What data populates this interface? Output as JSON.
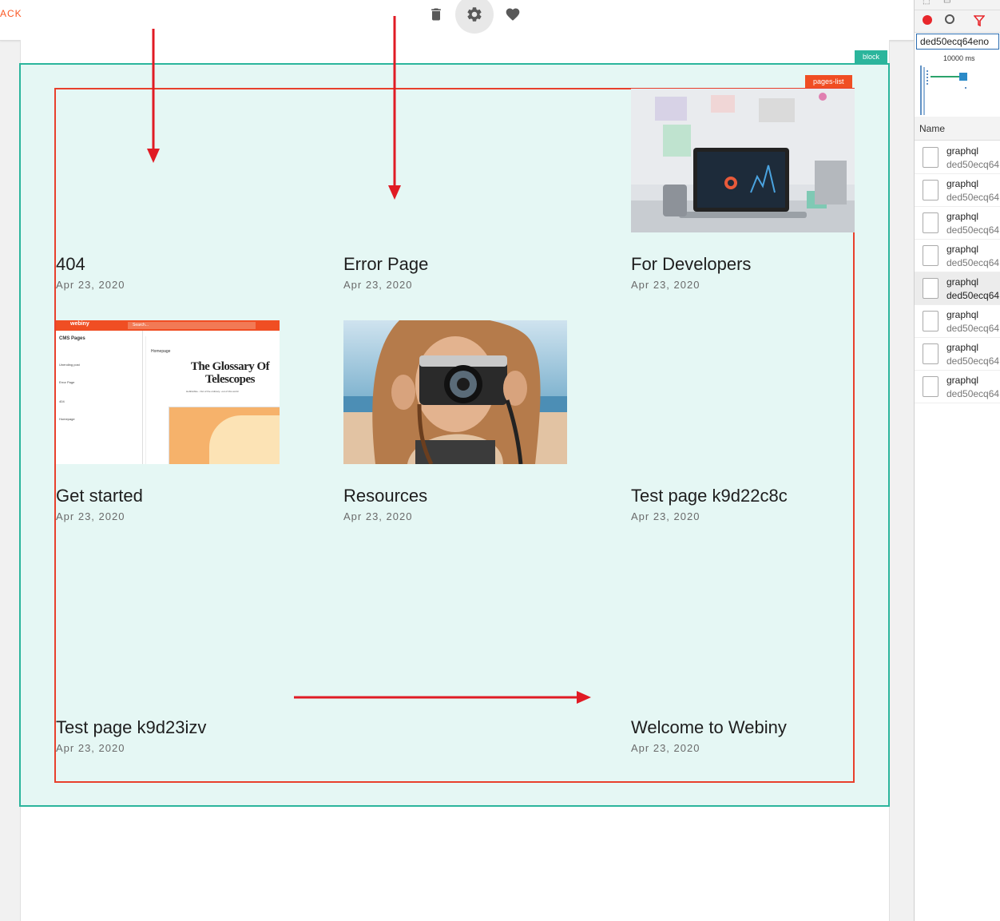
{
  "topbar": {
    "back_label": "ACK",
    "icons": [
      "delete-icon",
      "settings-gear-icon",
      "favorite-heart-icon"
    ]
  },
  "editor": {
    "block_tag": "block",
    "pages_list_tag": "pages-list"
  },
  "pages": [
    {
      "title": "404",
      "date": "Apr 23, 2020",
      "thumbnail": "none"
    },
    {
      "title": "Error Page",
      "date": "Apr 23, 2020",
      "thumbnail": "none"
    },
    {
      "title": "For Developers",
      "date": "Apr 23, 2020",
      "thumbnail": "laptop-dashboard-photo"
    },
    {
      "title": "Get started",
      "date": "Apr 23, 2020",
      "thumbnail": "cms-screenshot"
    },
    {
      "title": "Resources",
      "date": "Apr 23, 2020",
      "thumbnail": "camera-photo"
    },
    {
      "title": "Test page k9d22c8c",
      "date": "Apr 23, 2020",
      "thumbnail": "none"
    },
    {
      "title": "Test page k9d23izv",
      "date": "Apr 23, 2020",
      "thumbnail": "none"
    },
    {
      "title": "Welcome to Webiny",
      "date": "Apr 23, 2020",
      "thumbnail": "none"
    }
  ],
  "thumb_cms": {
    "logo": "webiny",
    "search": "Search...",
    "panel_title": "CMS Pages",
    "preview_label": "Homepage",
    "heading": "The Glossary Of Telescopes",
    "tagline": "HubbleSite - Out of the ordinary...out of this world",
    "rows": [
      "Unending post",
      "Error Page",
      "404",
      "Homepage"
    ]
  },
  "devtools": {
    "filter_value": "ded50ecq64eno",
    "timeline_label": "10000 ms",
    "name_header": "Name",
    "requests": [
      {
        "name": "graphql",
        "sub": "ded50ecq64"
      },
      {
        "name": "graphql",
        "sub": "ded50ecq64"
      },
      {
        "name": "graphql",
        "sub": "ded50ecq64"
      },
      {
        "name": "graphql",
        "sub": "ded50ecq64"
      },
      {
        "name": "graphql",
        "sub": "ded50ecq64"
      },
      {
        "name": "graphql",
        "sub": "ded50ecq64"
      },
      {
        "name": "graphql",
        "sub": "ded50ecq64"
      },
      {
        "name": "graphql",
        "sub": "ded50ecq64"
      }
    ]
  },
  "colors": {
    "accent": "#fa5723",
    "block_border": "#2bb59c",
    "block_bg": "#e5f7f4",
    "pages_list_border": "#e8402c",
    "annotation_arrow": "#e01b24"
  }
}
